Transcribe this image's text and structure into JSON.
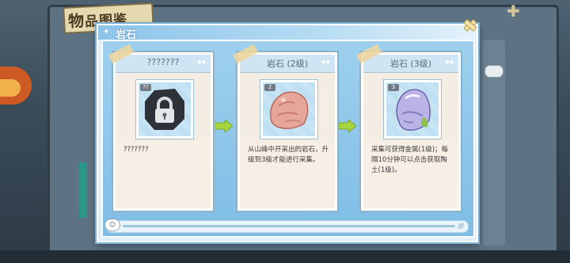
{
  "background": {
    "title_first_char": "物",
    "title_rest": "品图鉴"
  },
  "dialog": {
    "title": "岩石"
  },
  "cards": [
    {
      "name": "???????",
      "level": "??",
      "icon": "locked-rock-icon",
      "description": "???????"
    },
    {
      "name": "岩石 (2级)",
      "level": "2",
      "icon": "pink-rock-icon",
      "description": "从山峰中开采出的岩石，升级到3级才能进行采集。"
    },
    {
      "name": "岩石 (3级)",
      "level": "3",
      "icon": "purple-rock-icon",
      "description": "采集可获得金属(1级)；每隔10分钟可以点击获取陶土(1级)。"
    }
  ],
  "colors": {
    "accent": "#8cc4ea",
    "arrow": "#a6d63f",
    "lock": "#2d3238"
  }
}
